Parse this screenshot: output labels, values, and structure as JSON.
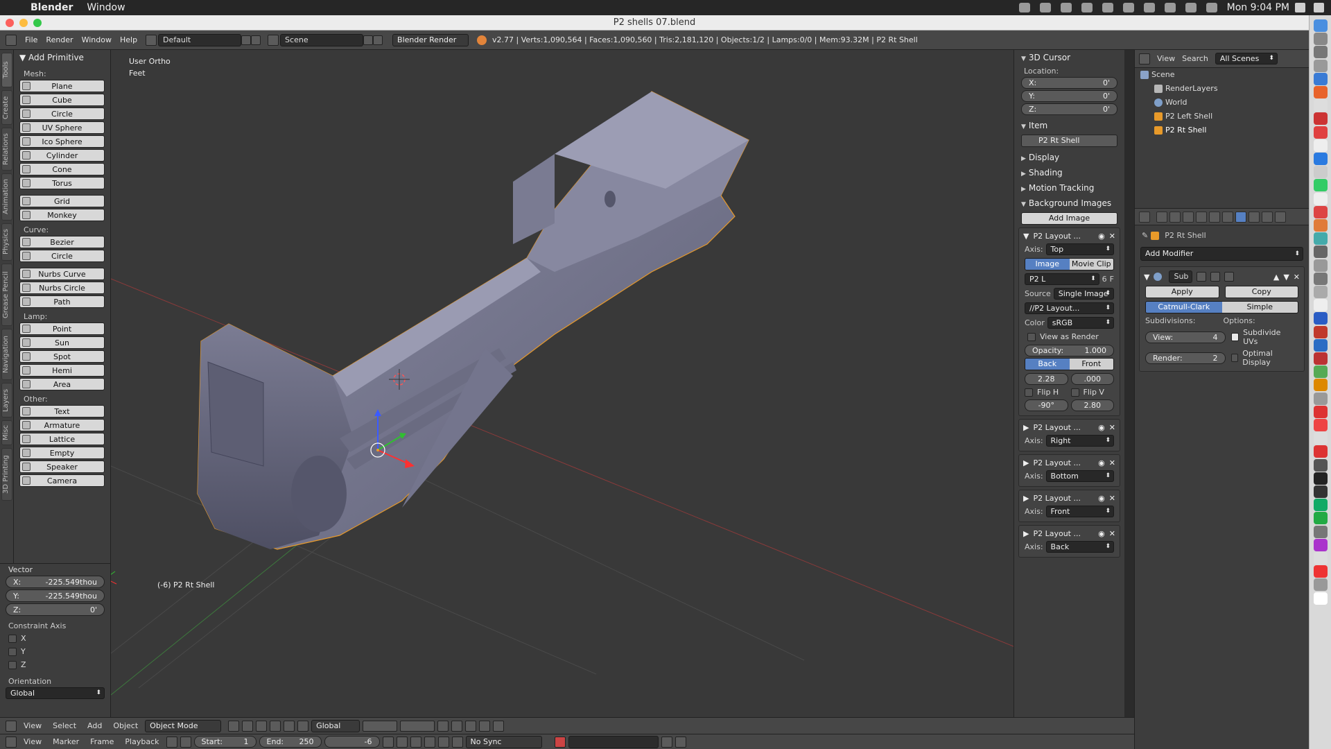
{
  "menubar": {
    "app_name": "Blender",
    "menu_window": "Window",
    "clock": "Mon 9:04 PM"
  },
  "window": {
    "title": "P2 shells 07.blend"
  },
  "info_header": {
    "menus": [
      "File",
      "Render",
      "Window",
      "Help"
    ],
    "layout": "Default",
    "scene": "Scene",
    "engine": "Blender Render",
    "stats": "v2.77 | Verts:1,090,564 | Faces:1,090,560 | Tris:2,181,120 | Objects:1/2 | Lamps:0/0 | Mem:93.32M | P2 Rt Shell"
  },
  "left_tabs": [
    "Tools",
    "Create",
    "Relations",
    "Animation",
    "Physics",
    "Grease Pencil",
    "Navigation",
    "Layers",
    "Misc",
    "3D Printing"
  ],
  "tool_shelf": {
    "title": "Add Primitive",
    "mesh_label": "Mesh:",
    "mesh": [
      "Plane",
      "Cube",
      "Circle",
      "UV Sphere",
      "Ico Sphere",
      "Cylinder",
      "Cone",
      "Torus"
    ],
    "mesh2": [
      "Grid",
      "Monkey"
    ],
    "curve_label": "Curve:",
    "curve": [
      "Bezier",
      "Circle"
    ],
    "curve2": [
      "Nurbs Curve",
      "Nurbs Circle",
      "Path"
    ],
    "lamp_label": "Lamp:",
    "lamp": [
      "Point",
      "Sun",
      "Spot",
      "Hemi",
      "Area"
    ],
    "other_label": "Other:",
    "other": [
      "Text",
      "Armature",
      "Lattice",
      "Empty",
      "Speaker",
      "Camera"
    ]
  },
  "operator": {
    "title": "Vector",
    "x_label": "X:",
    "x_value": "-225.549thou",
    "y_label": "Y:",
    "y_value": "-225.549thou",
    "z_label": "Z:",
    "z_value": "0'",
    "constraint_label": "Constraint Axis",
    "axes": [
      "X",
      "Y",
      "Z"
    ],
    "orientation_label": "Orientation",
    "orientation_value": "Global"
  },
  "viewport": {
    "view_name": "User Ortho",
    "units": "Feet",
    "object_label": "(-6) P2 Rt Shell"
  },
  "n_panel": {
    "cursor_title": "3D Cursor",
    "location_label": "Location:",
    "loc_x_label": "X:",
    "loc_x": "0'",
    "loc_y_label": "Y:",
    "loc_y": "0'",
    "loc_z_label": "Z:",
    "loc_z": "0'",
    "item_title": "Item",
    "item_name": "P2 Rt Shell",
    "display_title": "Display",
    "shading_title": "Shading",
    "motion_title": "Motion Tracking",
    "bg_title": "Background Images",
    "add_image": "Add Image",
    "bg1_name": "P2 Layout ...",
    "axis_label": "Axis:",
    "bg1_axis": "Top",
    "tab_image": "Image",
    "tab_movie": "Movie Clip",
    "img_field": "P2 L",
    "img_users": "6",
    "img_f": "F",
    "source_label": "Source",
    "source_value": "Single Image",
    "path_value": "//P2 Layout...",
    "color_label": "Color",
    "color_value": "sRGB",
    "view_as_render": "View as Render",
    "opacity_label": "Opacity:",
    "opacity_value": "1.000",
    "back_label": "Back",
    "front_label": "Front",
    "offset_x": "2.28",
    "offset_y": ".000",
    "flip_h": "Flip H",
    "flip_v": "Flip V",
    "rotation": "-90°",
    "size": "2.80",
    "bg_items": [
      {
        "name": "P2 Layout ...",
        "axis": "Right"
      },
      {
        "name": "P2 Layout ...",
        "axis": "Bottom"
      },
      {
        "name": "P2 Layout ...",
        "axis": "Front"
      },
      {
        "name": "P2 Layout ...",
        "axis": "Back"
      }
    ]
  },
  "outliner": {
    "header_view": "View",
    "header_search": "Search",
    "header_scenes": "All Scenes",
    "items": [
      "Scene",
      "RenderLayers",
      "World",
      "P2 Left Shell",
      "P2 Rt Shell"
    ]
  },
  "properties": {
    "object_name": "P2 Rt Shell",
    "add_modifier": "Add Modifier",
    "mod_name": "Sub",
    "apply": "Apply",
    "copy": "Copy",
    "catmull": "Catmull-Clark",
    "simple": "Simple",
    "subdivisions_label": "Subdivisions:",
    "options_label": "Options:",
    "view_label": "View:",
    "view_value": "4",
    "render_label": "Render:",
    "render_value": "2",
    "subdivide_uvs": "Subdivide UVs",
    "optimal_display": "Optimal Display"
  },
  "vp_header": {
    "menus": [
      "View",
      "Select",
      "Add",
      "Object"
    ],
    "mode": "Object Mode",
    "orientation": "Global"
  },
  "timeline": {
    "menus": [
      "View",
      "Marker",
      "Frame",
      "Playback"
    ],
    "start_label": "Start:",
    "start": "1",
    "end_label": "End:",
    "end": "250",
    "current": "-6",
    "sync": "No Sync"
  },
  "colors": {
    "accent": "#5680c2",
    "selection_outline": "#e89a2a",
    "mesh": "#6e6f86"
  }
}
